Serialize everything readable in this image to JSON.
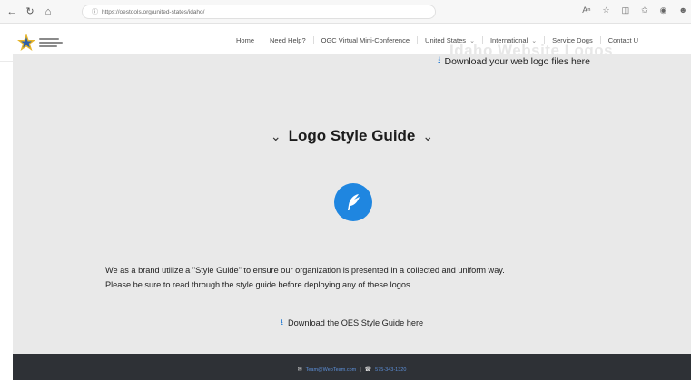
{
  "browser": {
    "url": "https://oestools.org/united-states/idaho/",
    "back_glyph": "←",
    "refresh_glyph": "↻",
    "home_glyph": "⌂",
    "lock_glyph": "🔒",
    "icons": [
      "reader-icon",
      "favorite-icon",
      "split-icon",
      "collections-icon",
      "extensions-icon",
      "profile-icon"
    ]
  },
  "header": {
    "nav": [
      {
        "label": "Home",
        "dropdown": false
      },
      {
        "label": "Need Help?",
        "dropdown": false
      },
      {
        "label": "OGC Virtual Mini-Conference",
        "dropdown": false
      },
      {
        "label": "United States",
        "dropdown": true
      },
      {
        "label": "International",
        "dropdown": true
      },
      {
        "label": "Service Dogs",
        "dropdown": false
      },
      {
        "label": "Contact U",
        "dropdown": false
      }
    ],
    "ghost_heading": "Idaho Website Logos"
  },
  "download_band": {
    "logo_link": "Download your web logo files here"
  },
  "section": {
    "title": "Logo Style Guide",
    "body_line_1": "We as a brand utilize a \"Style Guide\" to ensure our organization is presented in a collected and uniform way.",
    "body_line_2": "Please be sure to read through the style guide before deploying any of these logos.",
    "guide_link": "Download the OES Style Guide here"
  },
  "footer": {
    "email": "Team@WebTeam.com",
    "separator": "|",
    "phone": "575-343-1320"
  },
  "colors": {
    "accent": "#1f86e0",
    "band_bg": "#e9e9e9",
    "footer_bg": "#2e3136"
  }
}
